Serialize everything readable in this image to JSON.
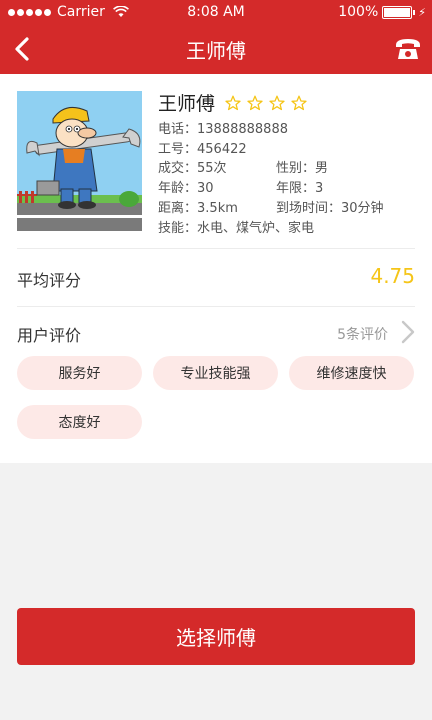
{
  "status_bar": {
    "carrier": "Carrier",
    "time": "8:08 AM",
    "battery": "100%"
  },
  "nav": {
    "title": "王师傅",
    "back_icon": "chevron-left-icon",
    "phone_icon": "phone-icon"
  },
  "profile": {
    "name": "王师傅",
    "rating_stars": 4,
    "rating_stars_max": 4,
    "phone_label": "电话：",
    "phone": "13888888888",
    "id_label": "工号：",
    "id": "456422",
    "deals_label": "成交：",
    "deals": "55次",
    "gender_label": "性别：",
    "gender": "男",
    "age_label": "年龄：",
    "age": "30",
    "years_label": "年限：",
    "years": "3",
    "distance_label": "距离：",
    "distance": "3.5km",
    "arrival_label": "到场时间：",
    "arrival": "30分钟",
    "skills_label": "技能：",
    "skills": "水电、煤气炉、家电"
  },
  "average": {
    "label": "平均评分",
    "score": "4.75"
  },
  "reviews": {
    "label": "用户评价",
    "count": "5条评价",
    "tags": [
      "服务好",
      "专业技能强",
      "维修速度快",
      "态度好"
    ]
  },
  "action": {
    "select_label": "选择师傅"
  },
  "colors": {
    "brand_red": "#d42a2a",
    "star_yellow": "#f5c518",
    "tag_bg": "#fde9e7"
  }
}
